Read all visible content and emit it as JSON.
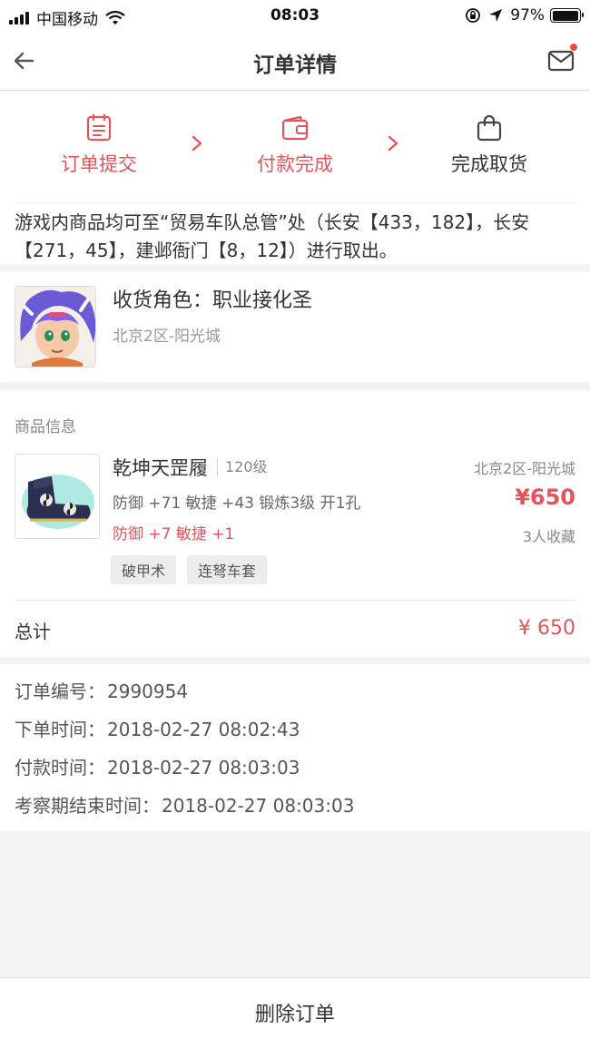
{
  "status_bar": {
    "carrier": "中国移动",
    "time": "08:03",
    "battery": "97%",
    "battery_level": 0.97
  },
  "nav": {
    "title": "订单详情",
    "back_icon": "back-arrow-icon",
    "mail_icon": "mail-icon"
  },
  "steps": [
    {
      "label": "订单提交",
      "icon": "clipboard-icon"
    },
    {
      "label": "付款完成",
      "icon": "wallet-icon"
    },
    {
      "label": "完成取货",
      "icon": "bag-icon"
    }
  ],
  "notice": "游戏内商品均可至“贸易车队总管”处（长安【433，182】，长安【271，45】，建邺衙门【8，12】）进行取出。",
  "receiver": {
    "name": "收货角色：职业接化圣",
    "server": "北京2区-阳光城"
  },
  "goods": {
    "header": "商品信息",
    "item": {
      "name": "乾坤天罡履",
      "level": "120级",
      "stats": "防御 +71 敏捷 +43 锻炼3级 开1孔",
      "extra": "防御 +7 敏捷 +1",
      "server": "北京2区-阳光城",
      "price": "¥650",
      "favorites": "3人收藏",
      "tags": [
        "破甲术",
        "连弩车套"
      ]
    },
    "total_label": "总计",
    "total_value": "¥ 650"
  },
  "order_info": [
    {
      "label": "订单编号：",
      "value": "2990954"
    },
    {
      "label": "下单时间：",
      "value": "2018-02-27 08:02:43"
    },
    {
      "label": "付款时间：",
      "value": "2018-02-27 08:03:03"
    },
    {
      "label": "考察期结束时间：",
      "value": "2018-02-27 08:03:03"
    }
  ],
  "bottom": {
    "delete_label": "删除订单"
  },
  "colors": {
    "accent": "#e2555a",
    "background": "#f3f3f3"
  }
}
